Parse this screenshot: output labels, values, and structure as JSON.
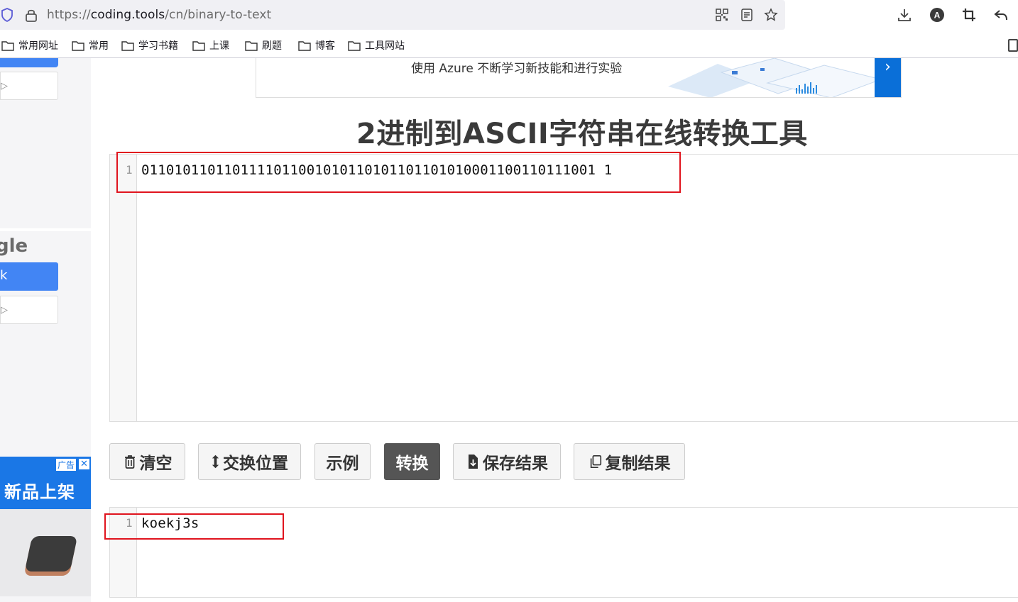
{
  "browser": {
    "url_prefix": "https://",
    "url_host": "coding.tools",
    "url_path": "/cn/binary-to-text"
  },
  "bookmarks": [
    "常用网址",
    "常用",
    "学习书籍",
    "上课",
    "刷题",
    "博客",
    "工具网站"
  ],
  "sidebar": {
    "partial_word": "gle",
    "blue_button_text": "k",
    "ad_tag": "广告",
    "ad_close": "✕",
    "ad_title": "新品上架"
  },
  "banner": {
    "text": "使用 Azure 不断学习新技能和进行实验",
    "arrow": "›"
  },
  "page": {
    "title": "2进制到ASCII字符串在线转换工具"
  },
  "input_editor": {
    "line_number": "1",
    "content": "0110101101101111011001010110101101101010001100110111001 1"
  },
  "buttons": {
    "clear": "清空",
    "swap": "交换位置",
    "example": "示例",
    "convert": "转换",
    "save": "保存结果",
    "copy": "复制结果"
  },
  "output_editor": {
    "line_number": "1",
    "content": "koekj3s"
  }
}
